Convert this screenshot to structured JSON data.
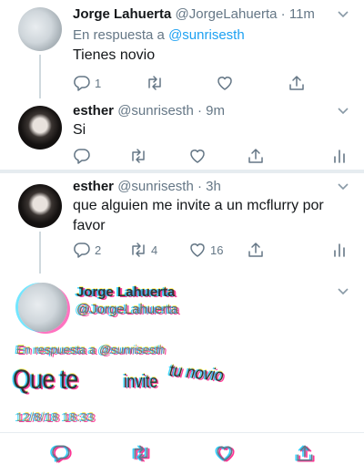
{
  "tweets": [
    {
      "name": "Jorge Lahuerta",
      "handle": "@JorgeLahuerta",
      "time": "11m",
      "reply_prefix": "En respuesta a",
      "reply_mention": "@sunrisesth",
      "text": "Tienes novio",
      "reply_count": "1",
      "retweet_count": "",
      "like_count": ""
    },
    {
      "name": "esther",
      "handle": "@sunrisesth",
      "time": "9m",
      "text": "Si"
    },
    {
      "name": "esther",
      "handle": "@sunrisesth",
      "time": "3h",
      "text": "que alguien me invite a un mcflurry por favor",
      "reply_count": "2",
      "retweet_count": "4",
      "like_count": "16"
    }
  ],
  "detail": {
    "name": "Jorge Lahuerta",
    "handle": "@JorgeLahuerta",
    "reply_prefix": "En respuesta a",
    "reply_mention": "@sunrisesth",
    "text_big": "Que te",
    "text_mid": "invite",
    "text_small": "tu novio",
    "timestamp": "12/8/18 18:33"
  },
  "colors": {
    "accent": "#1da1f2",
    "muted": "#657786",
    "text": "#14171a",
    "divider": "#e6ecf0"
  },
  "icons": [
    "reply-icon",
    "retweet-icon",
    "like-icon",
    "share-icon",
    "analytics-icon",
    "chevron-down-icon"
  ]
}
